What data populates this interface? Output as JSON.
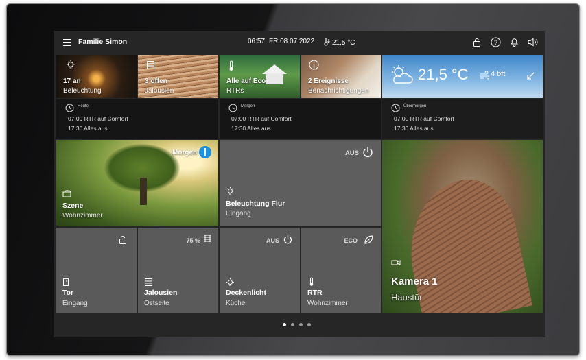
{
  "header": {
    "home_name": "Familie Simon",
    "time": "06:57",
    "date": "FR 08.07.2022",
    "temperature": "21,5 °C"
  },
  "info_tiles": [
    {
      "value": "17 an",
      "label": "Beleuchtung",
      "icon": "light-bulb-icon"
    },
    {
      "value": "3 offen",
      "label": "Jalousien",
      "icon": "blinds-icon"
    },
    {
      "value": "Alle auf Eco",
      "label": "RTRs",
      "icon": "thermometer-icon"
    },
    {
      "value": "2 Ereignisse",
      "label": "Benachrichtigungen",
      "icon": "info-icon"
    }
  ],
  "weather": {
    "temperature": "21,5 °C",
    "wind": "4 bft",
    "icon": "partly-cloudy-icon"
  },
  "schedule": [
    {
      "day": "Heute",
      "line1": "07:00 RTR auf Comfort",
      "line2": "17:30 Alles aus"
    },
    {
      "day": "Morgen",
      "line1": "07:00 RTR auf Comfort",
      "line2": "17:30 Alles aus"
    },
    {
      "day": "Übermorgen",
      "line1": "07:00 RTR auf Comfort",
      "line2": "17:30 Alles aus"
    }
  ],
  "scene": {
    "badge": "Morgen",
    "title": "Szene",
    "subtitle": "Wohnzimmer"
  },
  "flur": {
    "state": "AUS",
    "title": "Beleuchtung Flur",
    "subtitle": "Eingang"
  },
  "camera": {
    "title": "Kamera 1",
    "subtitle": "Haustür"
  },
  "small_tiles": [
    {
      "state": "",
      "title": "Tor",
      "subtitle": "Eingang",
      "icon": "gate-icon"
    },
    {
      "state": "75 %",
      "title": "Jalousien",
      "subtitle": "Ostseite",
      "icon": "blinds-icon"
    },
    {
      "state": "AUS",
      "title": "Deckenlicht",
      "subtitle": "Küche",
      "icon": "light-bulb-icon"
    },
    {
      "state": "ECO",
      "title": "RTR",
      "subtitle": "Wohnzimmer",
      "icon": "thermometer-icon"
    }
  ],
  "pagination": {
    "pages": 4,
    "active": 1
  },
  "colors": {
    "accent": "#1b8fe0",
    "tile": "#5a5a5a",
    "background": "#262626"
  }
}
